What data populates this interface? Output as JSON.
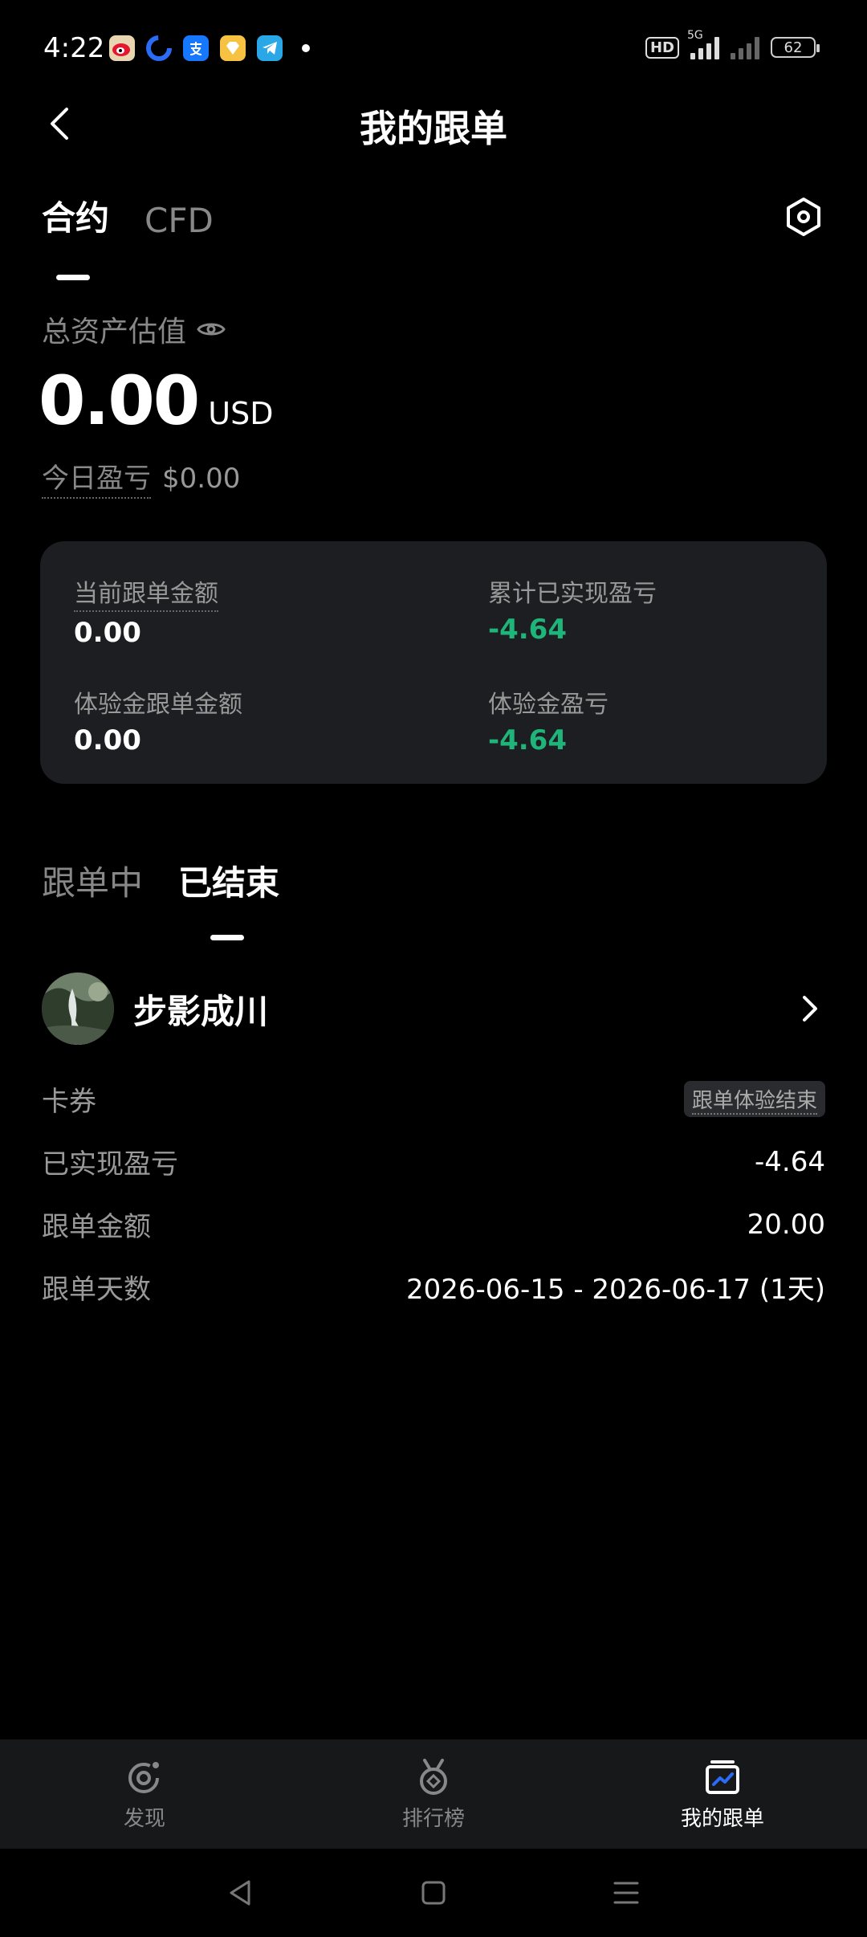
{
  "status_bar": {
    "time": "4:22",
    "hd": "HD",
    "network": "5G",
    "battery": "62"
  },
  "header": {
    "title": "我的跟单"
  },
  "top_tabs": [
    {
      "label": "合约",
      "active": true
    },
    {
      "label": "CFD",
      "active": false
    }
  ],
  "assets": {
    "label": "总资产估值",
    "value": "0.00",
    "unit": "USD",
    "today_pnl_label": "今日盈亏",
    "today_pnl_value": "$0.00"
  },
  "summary": {
    "current_amount_label": "当前跟单金额",
    "current_amount_value": "0.00",
    "realized_pnl_label": "累计已实现盈亏",
    "realized_pnl_value": "-4.64",
    "trial_amount_label": "体验金跟单金额",
    "trial_amount_value": "0.00",
    "trial_pnl_label": "体验金盈亏",
    "trial_pnl_value": "-4.64"
  },
  "follow_tabs": [
    {
      "label": "跟单中",
      "active": false
    },
    {
      "label": "已结束",
      "active": true
    }
  ],
  "record": {
    "trader_name": "步影成川",
    "coupon_label": "卡券",
    "coupon_tag": "跟单体验结束",
    "realized_label": "已实现盈亏",
    "realized_value": "-4.64",
    "amount_label": "跟单金额",
    "amount_value": "20.00",
    "days_label": "跟单天数",
    "days_value": "2026-06-15 - 2026-06-17 (1天)"
  },
  "bottom_nav": [
    {
      "label": "发现",
      "icon": "discover-icon",
      "active": false
    },
    {
      "label": "排行榜",
      "icon": "medal-icon",
      "active": false
    },
    {
      "label": "我的跟单",
      "icon": "my-follow-icon",
      "active": true
    }
  ],
  "colors": {
    "background": "#000000",
    "card": "#1d1e21",
    "loss_green": "#1fb57a",
    "muted": "#888888"
  }
}
